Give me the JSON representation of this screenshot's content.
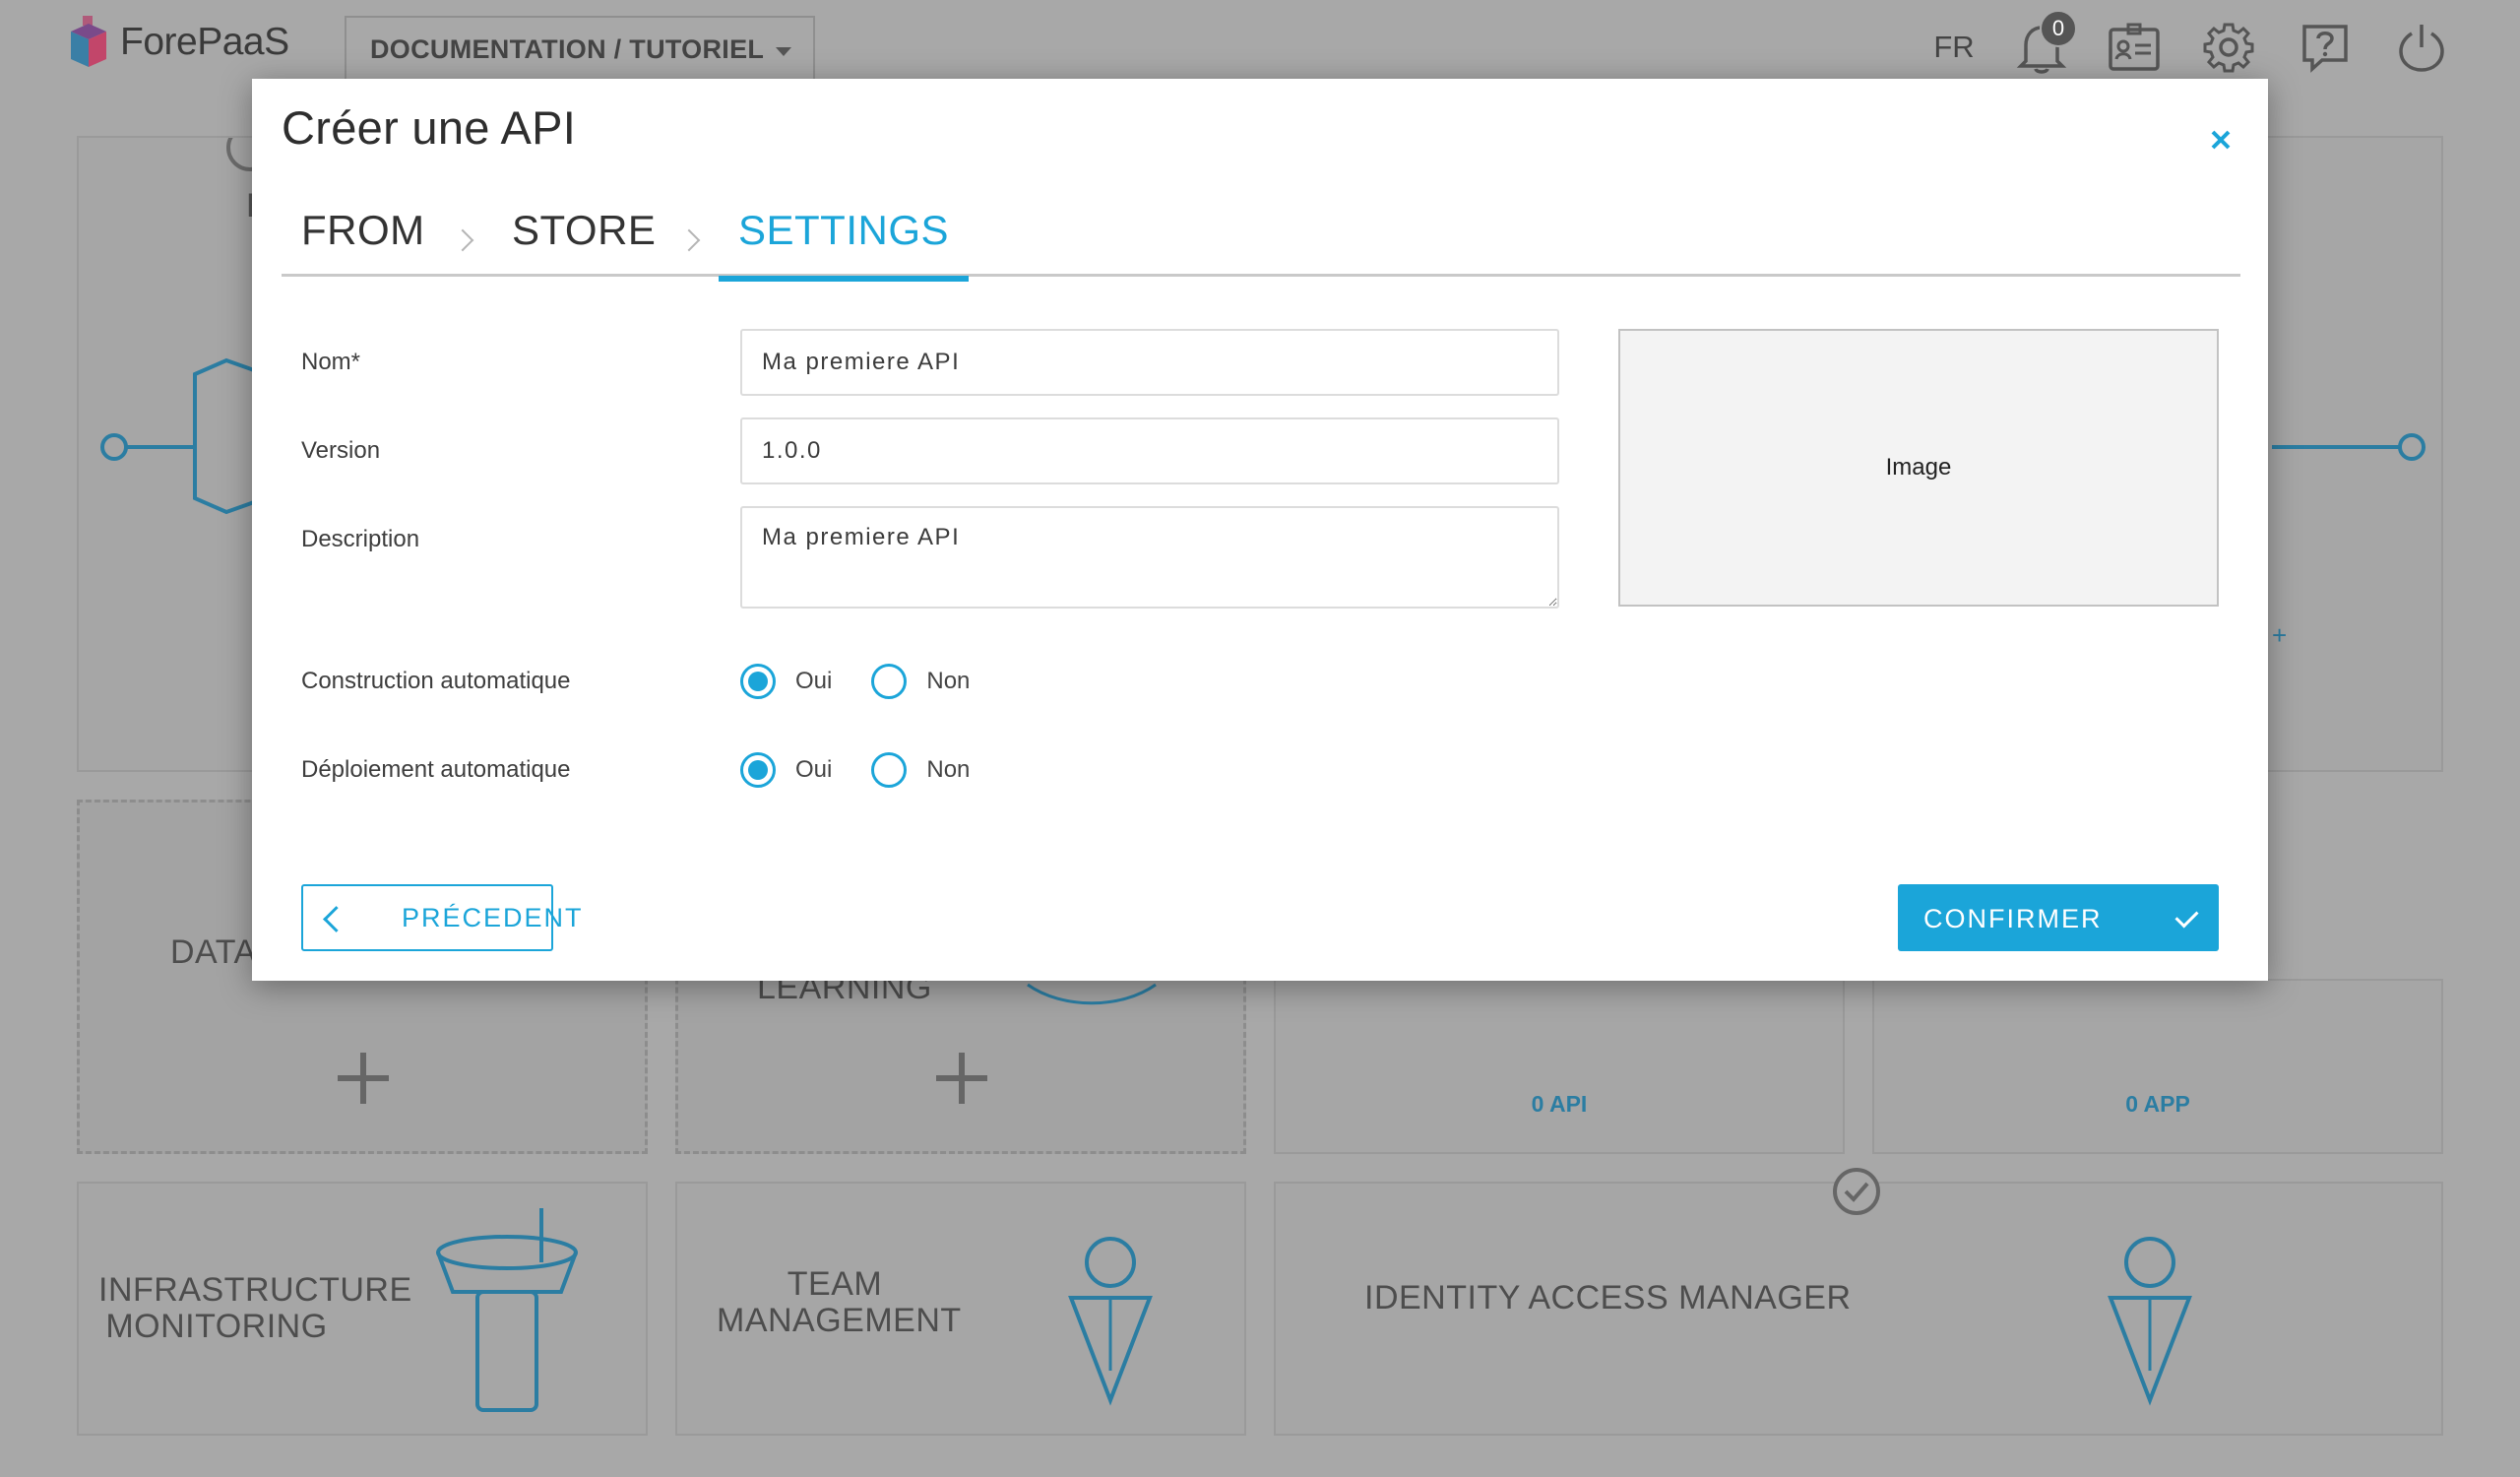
{
  "app": {
    "logo_text": "ForePaaS",
    "environment": "DOCUMENTATION / TUTORIEL",
    "language": "FR",
    "notification_count": "0"
  },
  "background": {
    "cards": [
      {
        "title": "DATA"
      },
      {
        "title": "LEARNING"
      },
      {
        "count": "0 API"
      },
      {
        "count": "0 APP"
      },
      {
        "title_line1": "INFRASTRUCTURE",
        "title_line2": "MONITORING"
      },
      {
        "title_line1": "TEAM",
        "title_line2": "MANAGEMENT"
      },
      {
        "title": "IDENTITY ACCESS MANAGER"
      }
    ],
    "partial_letter": "E"
  },
  "modal": {
    "title": "Créer une API",
    "steps": [
      {
        "label": "FROM",
        "active": false
      },
      {
        "label": "STORE",
        "active": false
      },
      {
        "label": "SETTINGS",
        "active": true
      }
    ],
    "form": {
      "name_label": "Nom*",
      "name_value": "Ma premiere API",
      "version_label": "Version",
      "version_value": "1.0.0",
      "description_label": "Description",
      "description_value": "Ma premiere API",
      "image_label": "Image",
      "auto_build_label": "Construction automatique",
      "auto_deploy_label": "Déploiement automatique",
      "yes_label": "Oui",
      "no_label": "Non",
      "auto_build_selected": "Oui",
      "auto_deploy_selected": "Oui"
    },
    "buttons": {
      "previous": "PRÉCEDENT",
      "confirm": "CONFIRMER"
    }
  },
  "colors": {
    "accent": "#1ba5d9",
    "overlay_background": "#a8a8a8",
    "icon_teal": "#2b7da2"
  }
}
